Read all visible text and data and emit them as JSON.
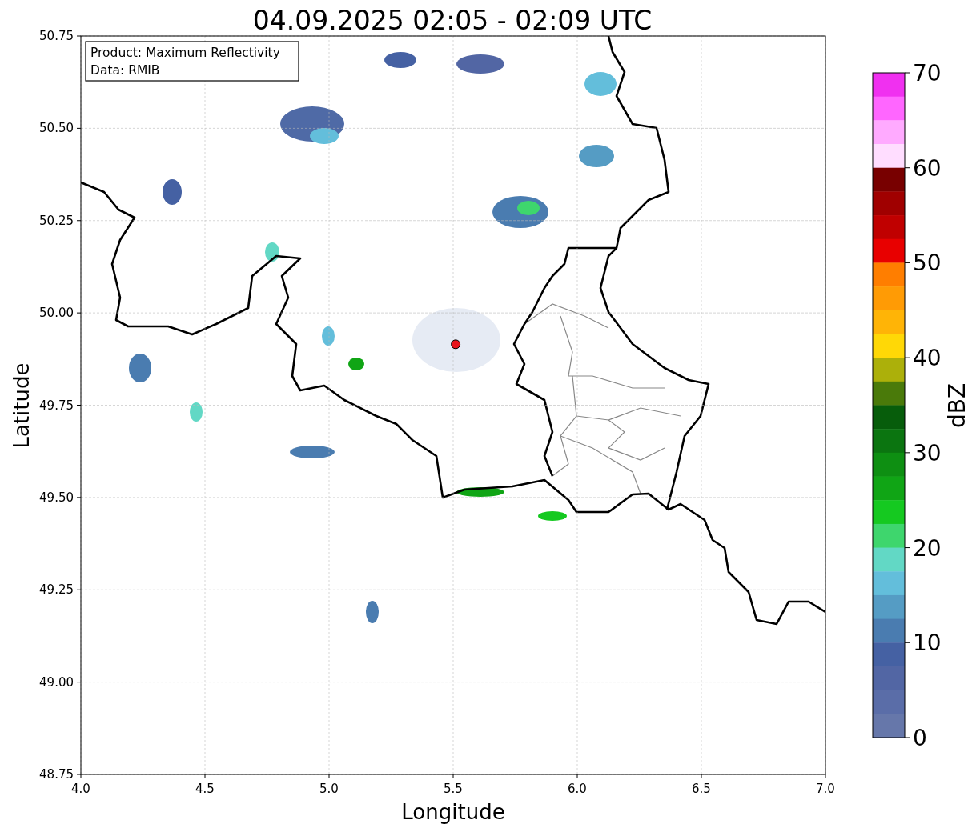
{
  "plot": {
    "chart_data": {
      "type": "scatter",
      "title": "04.09.2025 02:05 - 02:09 UTC",
      "xlabel": "Longitude",
      "ylabel": "Latitude",
      "xlim": [
        4,
        7
      ],
      "ylim": [
        48.75,
        50.75
      ],
      "grid": true,
      "xticks": [
        {
          "value": 4,
          "label": "4.0"
        },
        {
          "value": 4.5,
          "label": "4.5"
        },
        {
          "value": 5,
          "label": "5.0"
        },
        {
          "value": 5.5,
          "label": "5.5"
        },
        {
          "value": 6,
          "label": "6.0"
        },
        {
          "value": 6.5,
          "label": "6.5"
        },
        {
          "value": 7,
          "label": "7.0"
        }
      ],
      "yticks": [
        {
          "value": 48.75,
          "label": "48.75"
        },
        {
          "value": 49,
          "label": "49.00"
        },
        {
          "value": 49.25,
          "label": "49.25"
        },
        {
          "value": 49.5,
          "label": "49.50"
        },
        {
          "value": 49.75,
          "label": "49.75"
        },
        {
          "value": 50,
          "label": "50.00"
        },
        {
          "value": 50.25,
          "label": "50.25"
        },
        {
          "value": 50.5,
          "label": "50.50"
        },
        {
          "value": 50.75,
          "label": "50.75"
        }
      ],
      "x": [
        5.51
      ],
      "series": [
        {
          "color": "#e8141c",
          "values": [
            49.915
          ]
        }
      ]
    },
    "legend": [
      "Product: Maximum Reflectivity",
      "Data: RMIB"
    ]
  },
  "colorbar": {
    "label": "dBZ",
    "ticks": [
      "70",
      "60",
      "50",
      "40",
      "30",
      "20",
      "10",
      "0"
    ],
    "bands": [
      {
        "color": "#f030f0"
      },
      {
        "color": "#ff66ff"
      },
      {
        "color": "#ffaaff"
      },
      {
        "color": "#ffddff"
      },
      {
        "color": "#780000"
      },
      {
        "color": "#a00000"
      },
      {
        "color": "#c00000"
      },
      {
        "color": "#e80000"
      },
      {
        "color": "#ff7e00"
      },
      {
        "color": "#ff9b05"
      },
      {
        "color": "#ffb406"
      },
      {
        "color": "#ffd806"
      },
      {
        "color": "#acb00a"
      },
      {
        "color": "#4a7a0a"
      },
      {
        "color": "#075d0b"
      },
      {
        "color": "#0b7510"
      },
      {
        "color": "#0e8f12"
      },
      {
        "color": "#10a515"
      },
      {
        "color": "#15c920"
      },
      {
        "color": "#3ed66d"
      },
      {
        "color": "#62d8c5"
      },
      {
        "color": "#63bedb"
      },
      {
        "color": "#559cc4"
      },
      {
        "color": "#4a7cb0"
      },
      {
        "color": "#4561a3"
      },
      {
        "color": "#5266a4"
      },
      {
        "color": "#5a6da8"
      },
      {
        "color": "#6677aa"
      }
    ]
  }
}
